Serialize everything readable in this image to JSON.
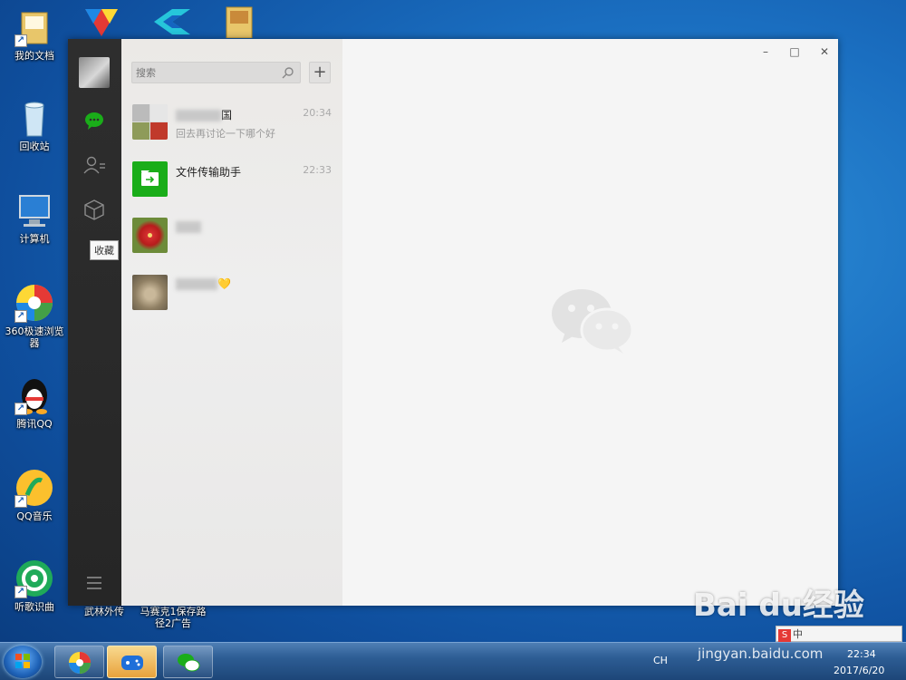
{
  "desktop": {
    "icons": [
      {
        "label": "我的文档"
      },
      {
        "label": "回收站"
      },
      {
        "label": "计算机"
      },
      {
        "label": "360极速浏览器"
      },
      {
        "label": "腾讯QQ"
      },
      {
        "label": "QQ音乐"
      },
      {
        "label": "听歌识曲"
      },
      {
        "label": "武林外传"
      },
      {
        "label": "马赛克1保存路径2广告"
      }
    ]
  },
  "wechat": {
    "search": {
      "placeholder": "搜索"
    },
    "add_label": "+",
    "tooltip": "收藏",
    "chats": [
      {
        "name_suffix": "国",
        "preview": "回去再讨论一下哪个好",
        "time": "20:34"
      },
      {
        "name": "文件传输助手",
        "preview": "",
        "time": "22:33"
      },
      {
        "name_suffix": "",
        "preview": "",
        "time": ""
      },
      {
        "name_suffix": "💛",
        "preview": "",
        "time": ""
      }
    ],
    "window_controls": {
      "minimize": "–",
      "maximize": "□",
      "close": "✕"
    }
  },
  "taskbar": {
    "lang": "CH",
    "clock_time": "22:34",
    "clock_date": "2017/6/20"
  },
  "ime": {
    "label": "中"
  },
  "watermark": {
    "brand": "Bai du经验",
    "url": "jingyan.baidu.com"
  },
  "colors": {
    "wechat_green": "#1aad19",
    "nav_bg": "#2e2e2e"
  }
}
